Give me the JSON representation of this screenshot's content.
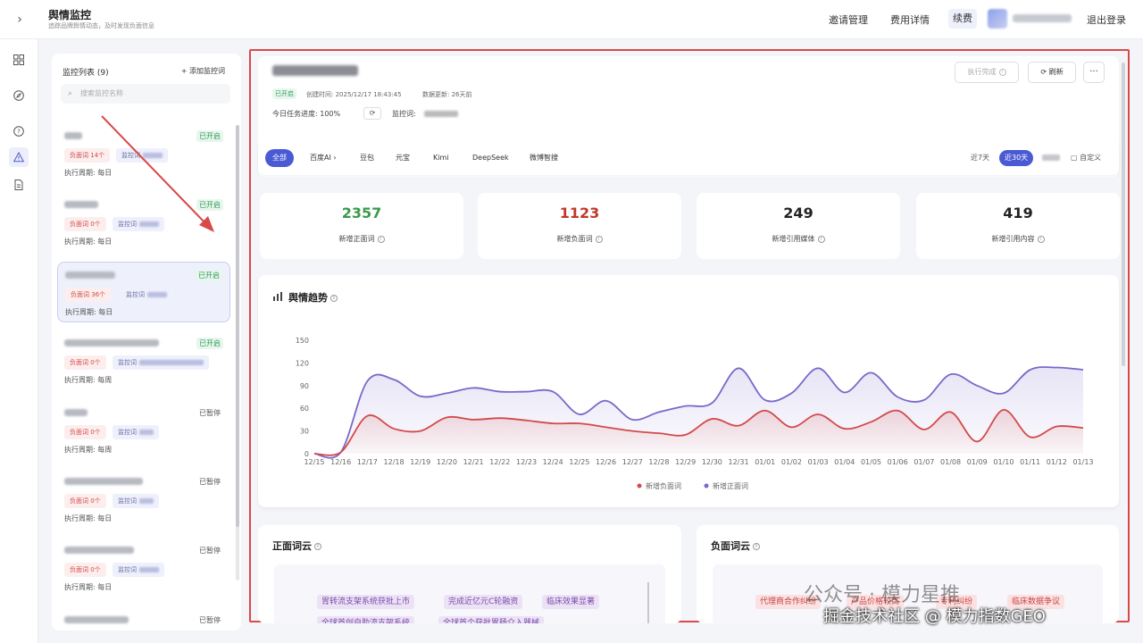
{
  "header": {
    "title": "舆情监控",
    "subtitle": "追踪品牌舆情动态，及时发现负面信息",
    "nav": [
      "邀请管理",
      "费用详情"
    ],
    "renew": "续费",
    "logout": "退出登录"
  },
  "list": {
    "heading": "监控列表 (9)",
    "add_label": "+ 添加监控词",
    "search_placeholder": "搜索监控名称",
    "items": [
      {
        "status": "已开启",
        "neg": "负面词 14个",
        "kw": "监控词",
        "period": "执行周期: 每日"
      },
      {
        "status": "已开启",
        "neg": "负面词 0个",
        "kw": "监控词",
        "period": "执行周期: 每日"
      },
      {
        "status": "已开启",
        "neg": "负面词 36个",
        "kw": "监控词",
        "period": "执行周期: 每日"
      },
      {
        "status": "已开启",
        "neg": "负面词 0个",
        "kw": "监控词",
        "period": "执行周期: 每周"
      },
      {
        "status": "已暂停",
        "neg": "负面词 0个",
        "kw": "监控词",
        "period": "执行周期: 每周"
      },
      {
        "status": "已暂停",
        "neg": "负面词 0个",
        "kw": "监控词",
        "period": "执行周期: 每日"
      },
      {
        "status": "已暂停",
        "neg": "负面词 0个",
        "kw": "监控词",
        "period": "执行周期: 每日"
      },
      {
        "status": "已暂停"
      }
    ]
  },
  "task": {
    "status": "已开启",
    "created": "创建时间: 2025/12/17 18:43:45",
    "updated": "数据更新: 26天前",
    "progress": "今日任务进度:  100%",
    "keyword_label": "监控词:",
    "btn_exec": "执行完成",
    "btn_refresh": "刷新",
    "btn_more": "···"
  },
  "filters": {
    "sources": [
      "全部",
      "百度AI",
      "豆包",
      "元宝",
      "Kimi",
      "DeepSeek",
      "微博智搜"
    ],
    "ranges": [
      "近7天",
      "近30天",
      "自定义"
    ]
  },
  "stats": [
    {
      "value": "2357",
      "label": "新增正面词",
      "color": "#3a9a4c"
    },
    {
      "value": "1123",
      "label": "新增负面词",
      "color": "#c0392b"
    },
    {
      "value": "249",
      "label": "新增引用媒体",
      "color": "#222222"
    },
    {
      "value": "419",
      "label": "新增引用内容",
      "color": "#222222"
    }
  ],
  "trend": {
    "title": "舆情趋势"
  },
  "chart_data": {
    "type": "area",
    "x": [
      "12/15",
      "12/16",
      "12/17",
      "12/18",
      "12/19",
      "12/20",
      "12/21",
      "12/22",
      "12/23",
      "12/24",
      "12/25",
      "12/26",
      "12/27",
      "12/28",
      "12/29",
      "12/30",
      "12/31",
      "01/01",
      "01/02",
      "01/03",
      "01/04",
      "01/05",
      "01/06",
      "01/07",
      "01/08",
      "01/09",
      "01/10",
      "01/11",
      "01/12",
      "01/13"
    ],
    "ylim": [
      0,
      150
    ],
    "yticks": [
      0,
      30,
      60,
      90,
      120,
      150
    ],
    "series": [
      {
        "name": "新增负面词",
        "color": "#d24a4a",
        "values": [
          0,
          2,
          50,
          33,
          30,
          48,
          45,
          47,
          44,
          40,
          40,
          35,
          30,
          27,
          25,
          46,
          37,
          57,
          35,
          52,
          33,
          42,
          57,
          32,
          55,
          16,
          58,
          22,
          36,
          34
        ]
      },
      {
        "name": "新增正面词",
        "color": "#7b68c9",
        "values": [
          0,
          2,
          96,
          98,
          76,
          80,
          87,
          82,
          82,
          82,
          52,
          70,
          45,
          55,
          63,
          67,
          113,
          71,
          80,
          113,
          81,
          107,
          75,
          71,
          105,
          90,
          80,
          111,
          114,
          111
        ]
      }
    ],
    "grid": false,
    "legend": "bottom"
  },
  "clouds": {
    "positive_title": "正面词云",
    "negative_title": "负面词云",
    "positive_words": [
      "胃转流支架系统获批上市",
      "完成近亿元C轮融资",
      "临床效果显著",
      "全球首创自助流支架系统",
      "全球首个获批胃肠介入器械"
    ],
    "negative_words": [
      "代理商合作纠纷",
      "产品价格较高",
      "专利纠纷",
      "临床数据争议"
    ]
  },
  "watermark": {
    "line1": "公众号 · 模力星推",
    "line2": "掘金技术社区 @ 模力指数GEO"
  }
}
